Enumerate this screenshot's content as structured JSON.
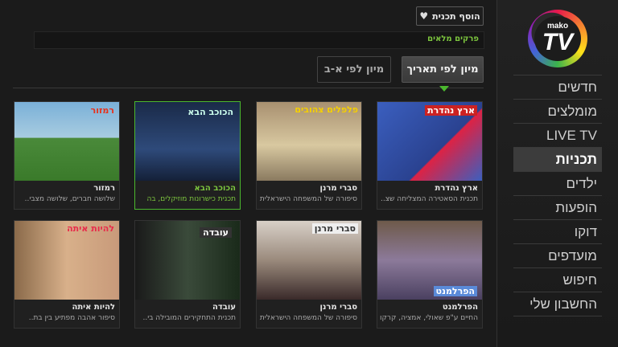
{
  "brand": {
    "mako": "mako",
    "tv": "TV"
  },
  "sidebar": {
    "items": [
      {
        "label": "חדשים"
      },
      {
        "label": "מומלצים"
      },
      {
        "label": "LIVE TV"
      },
      {
        "label": "תכניות",
        "active": true
      },
      {
        "label": "ילדים"
      },
      {
        "label": "הופעות"
      },
      {
        "label": "דוקו"
      },
      {
        "label": "מועדפים"
      },
      {
        "label": "חיפוש"
      },
      {
        "label": "החשבון שלי"
      }
    ]
  },
  "header": {
    "favorite_label": "הוסף תכנית",
    "favorite_icon": "heart-plus-icon",
    "breadcrumb": "פרקים מלאים"
  },
  "sort": {
    "by_date": "מיון לפי תאריך",
    "by_abc": "מיון לפי א-ב",
    "active": "by_date"
  },
  "shows": [
    {
      "title": "ארץ נהדרת",
      "subtitle": "תכנית הסאטירה המצליחה  שצ..",
      "thumb_text": "ארץ נהדרת",
      "thumb_color": "#3b5fbf"
    },
    {
      "title": "סברי מרנן",
      "subtitle": "סיפורה של המשפחה הישראלית",
      "thumb_text": "פלפלים צהובים",
      "thumb_color": "#c9b48a"
    },
    {
      "title": "הכוכב הבא",
      "subtitle": "תכנית כישרונות מוזיקלים, בה",
      "thumb_text": "הכוכב הבא",
      "thumb_color": "#22355a",
      "selected": true
    },
    {
      "title": "רמזור",
      "subtitle": "שלושה חברים, שלושה מצבי..",
      "thumb_text": "רמזור",
      "thumb_color": "#6aa0c8"
    },
    {
      "title": "הפרלמנט",
      "subtitle": "החיים ע\"פ שאולי, אמציה, קרקו",
      "thumb_text": "הפרלמנט",
      "thumb_color": "#7c6e8c"
    },
    {
      "title": "סברי מרנן",
      "subtitle": "סיפורה של המשפחה הישראלית",
      "thumb_text": "סברי מרנן",
      "thumb_color": "#9a8a7c"
    },
    {
      "title": "עובדה",
      "subtitle": "תכנית התחקירים המובילה בי..",
      "thumb_text": "עובדה",
      "thumb_color": "#2e3b2e"
    },
    {
      "title": "להיות איתה",
      "subtitle": "סיפור אהבה מפתיע בין בת..",
      "thumb_text": "להיות איתה",
      "thumb_color": "#b8866a"
    }
  ]
}
